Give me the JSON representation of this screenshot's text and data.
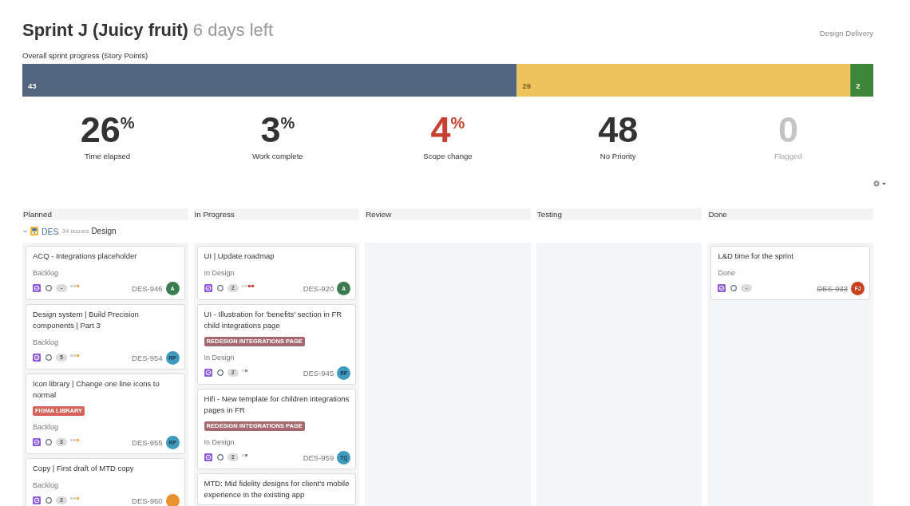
{
  "sprint": {
    "title": "Sprint J (Juicy fruit)",
    "time_left": "6 days left",
    "board": "Design Delivery"
  },
  "progress": {
    "chart_data": {
      "type": "bar",
      "orientation": "horizontal",
      "stacked": true,
      "title": "Overall sprint progress (Story Points)",
      "xlim": [
        0,
        74
      ],
      "series": [
        {
          "color": "#51657f",
          "values": [
            43
          ]
        },
        {
          "color": "#efc35b",
          "values": [
            29
          ]
        },
        {
          "color": "#3d8538",
          "values": [
            2
          ]
        }
      ],
      "data_labels": true
    }
  },
  "stats": [
    {
      "value": "26$^{%}$",
      "label": "Time elapsed",
      "kind": "normal"
    },
    {
      "value": "3$^{%}$",
      "label": "Work complete",
      "kind": "normal"
    },
    {
      "value": "4$^{%}$",
      "label": "Scope change",
      "kind": "alert"
    },
    {
      "value": "48",
      "label": "No Priority",
      "kind": "normal"
    },
    {
      "value": "0",
      "label": "Flagged",
      "kind": "muted"
    }
  ],
  "swimlane": {
    "expanded": true,
    "key": "DES",
    "count": "34 issues",
    "name": "Design"
  },
  "columns": [
    {
      "name": "Planned",
      "cards": [
        {
          "title": "ACQ - Integrations placeholder",
          "status": "Backlog",
          "estimate": "-",
          "priority": [
            {
              "color": "#cfcfcf"
            },
            {
              "color": "#cfcfcf"
            },
            {
              "color": "#f2a93b"
            }
          ],
          "key": "DES-946",
          "resolved": false,
          "assignee": {
            "initials": "A",
            "color": "#3a7b50"
          }
        },
        {
          "title": "Design system | Build Precision components | Part 3",
          "status": "Backlog",
          "estimate": "5",
          "priority": [
            {
              "color": "#cfcfcf"
            },
            {
              "color": "#cfcfcf"
            },
            {
              "color": "#f2a93b"
            }
          ],
          "key": "DES-954",
          "resolved": false,
          "assignee": {
            "initials": "RP",
            "color": "#3e9bbd"
          }
        },
        {
          "title": "Icon library | Change one line icons to normal",
          "labels": [
            {
              "text": "FIGMA LIBRARY",
              "color": "#d6635a"
            }
          ],
          "status": "Backlog",
          "estimate": "3",
          "priority": [
            {
              "color": "#cfcfcf"
            },
            {
              "color": "#cfcfcf"
            },
            {
              "color": "#f2a93b"
            }
          ],
          "key": "DES-955",
          "resolved": false,
          "assignee": {
            "initials": "RP",
            "color": "#3e9bbd"
          }
        },
        {
          "title": "Copy | First draft of MTD copy",
          "status": "Backlog",
          "estimate": "2",
          "priority": [
            {
              "color": "#cfcfcf"
            },
            {
              "color": "#cfcfcf"
            },
            {
              "color": "#f2a93b"
            }
          ],
          "key": "DES-960",
          "resolved": false,
          "assignee": {
            "color": "#e9912f"
          }
        }
      ]
    },
    {
      "name": "In Progress",
      "cards": [
        {
          "title": "UI | Update roadmap",
          "status": "In Design",
          "estimate": "2",
          "priority": [
            {
              "color": "#d6d6d6"
            },
            {
              "color": "#d6d6d6"
            },
            {
              "color": "#cf3f36"
            },
            {
              "color": "#cf3f36"
            }
          ],
          "key": "DES-920",
          "resolved": false,
          "assignee": {
            "initials": "A",
            "color": "#3a7b50"
          }
        },
        {
          "title": "UI - Illustration for 'benefits' section in FR child integrations page",
          "labels": [
            {
              "text": "REDESIGN INTEGRATIONS PAGE",
              "color": "#a5686c"
            }
          ],
          "status": "In Design",
          "estimate": "2",
          "priority": [
            {
              "color": "#d6d6d6"
            },
            {
              "color": "#8f8f8f"
            }
          ],
          "key": "DES-945",
          "resolved": false,
          "assignee": {
            "initials": "RP",
            "color": "#3e9bbd"
          }
        },
        {
          "title": "Hifi - New template for children integrations pages in FR",
          "labels": [
            {
              "text": "REDESIGN INTEGRATIONS PAGE",
              "color": "#a5686c"
            }
          ],
          "status": "In Design",
          "estimate": "2",
          "priority": [
            {
              "color": "#d6d6d6"
            },
            {
              "color": "#8f8f8f"
            }
          ],
          "key": "DES-959",
          "resolved": false,
          "assignee": {
            "initials": "TQ",
            "color": "#3e9bbd"
          }
        },
        {
          "title": "MTD: Mid fidelity designs for client's mobile experience in the existing app"
        }
      ]
    },
    {
      "name": "Review"
    },
    {
      "name": "Testing"
    },
    {
      "name": "Done",
      "cards": [
        {
          "title": "L&D time for the sprint",
          "status": "Done",
          "estimate": "-",
          "key": "DES-933",
          "resolved": true,
          "assignee": {
            "initials": "FJ",
            "color": "#c9411f"
          }
        }
      ]
    }
  ]
}
